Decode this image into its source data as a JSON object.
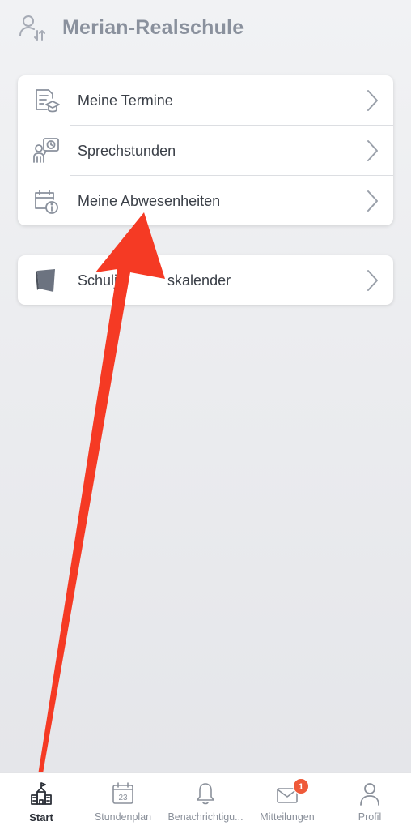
{
  "header": {
    "title": "Merian-Realschule",
    "switch_icon": "user-switch-icon"
  },
  "menu_card": {
    "items": [
      {
        "label": "Meine Termine",
        "icon": "document-graduation-icon"
      },
      {
        "label": "Sprechstunden",
        "icon": "consultation-clock-icon"
      },
      {
        "label": "Meine Abwesenheiten",
        "icon": "calendar-info-icon"
      }
    ]
  },
  "calendar_card": {
    "items": [
      {
        "label": "Schulj",
        "label_tail": "skalender",
        "icon": "book-icon"
      }
    ]
  },
  "tabbar": {
    "tabs": [
      {
        "label": "Start",
        "icon": "school-building-icon",
        "active": true
      },
      {
        "label": "Stundenplan",
        "icon": "calendar-23-icon",
        "calendar_day": "23"
      },
      {
        "label": "Benachrichtigu...",
        "icon": "bell-icon"
      },
      {
        "label": "Mitteilungen",
        "icon": "envelope-icon",
        "badge": "1"
      },
      {
        "label": "Profil",
        "icon": "person-icon"
      }
    ]
  },
  "colors": {
    "accent_arrow": "#f53a24",
    "badge": "#ef5a3a",
    "icon_gray": "#8a919d",
    "text": "#3a3f47"
  }
}
